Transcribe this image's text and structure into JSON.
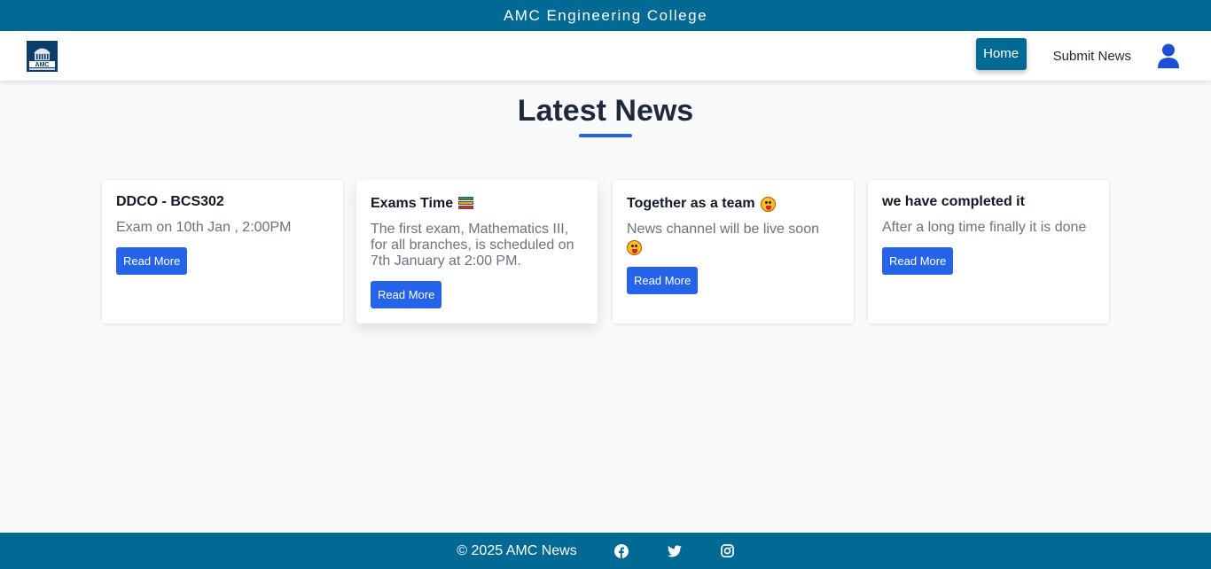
{
  "topbar": {
    "title": "AMC Engineering College"
  },
  "logo": {
    "alt_text": "AMC"
  },
  "nav": {
    "items": [
      {
        "label": "Home",
        "active": true
      },
      {
        "label": "Submit News",
        "active": false
      }
    ],
    "user_icon": "user-icon"
  },
  "main": {
    "title": "Latest News",
    "cards": [
      {
        "title": "DDCO - BCS302",
        "title_emoji": "",
        "text": "Exam on 10th Jan , 2:00PM",
        "button": "Read More"
      },
      {
        "title": "Exams Time",
        "title_emoji": "books-icon",
        "text": "The first exam, Mathematics III, for all branches, is scheduled on 7th January at 2:00 PM.",
        "button": "Read More"
      },
      {
        "title": "Together as a team",
        "title_emoji": "tongue-face-icon",
        "text": "News channel will be live soon",
        "text_emoji": "tongue-face-icon",
        "button": "Read More"
      },
      {
        "title": "we have completed it",
        "title_emoji": "",
        "text": "After a long time finally it is done",
        "button": "Read More"
      }
    ]
  },
  "footer": {
    "copyright": "© 2025 AMC News",
    "social": [
      "facebook-icon",
      "twitter-icon",
      "instagram-icon"
    ]
  },
  "colors": {
    "primary": "#006994",
    "accent": "#2563eb",
    "background": "#f8fafc"
  }
}
